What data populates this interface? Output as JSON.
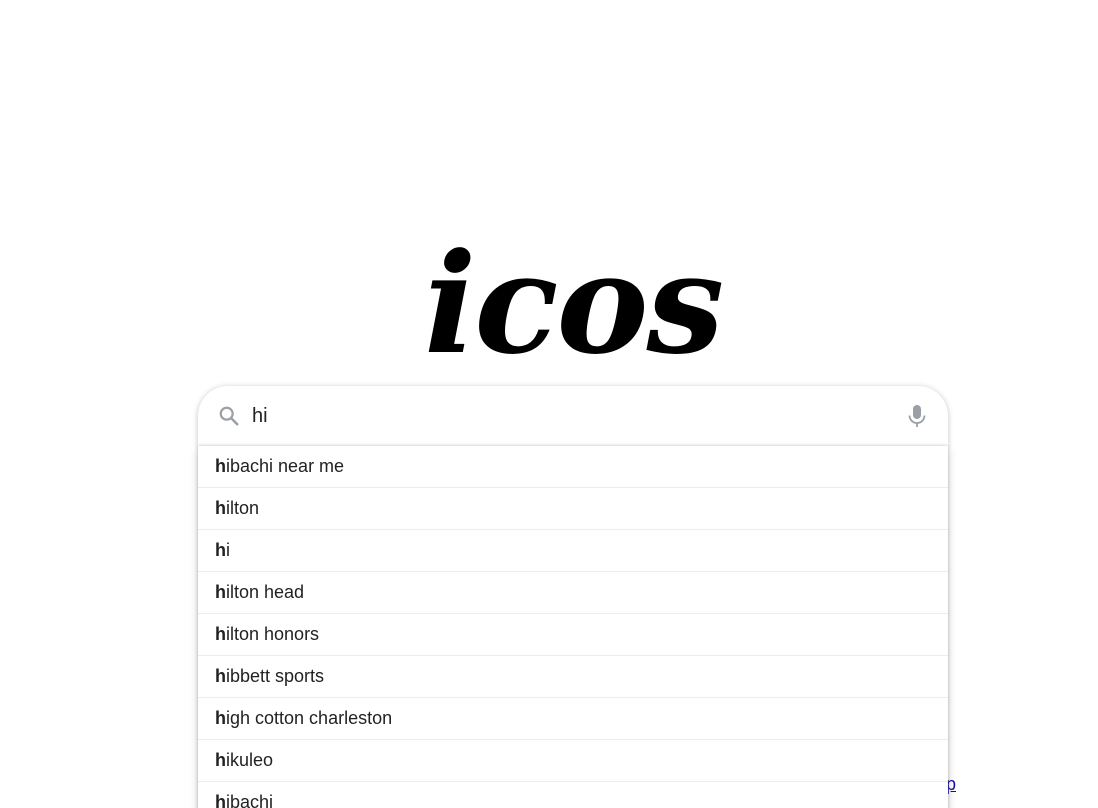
{
  "logo": {
    "text": "icos"
  },
  "search": {
    "value": "hi",
    "placeholder": ""
  },
  "suggestions": [
    {
      "prefix": "h",
      "rest": "ibachi near me"
    },
    {
      "prefix": "h",
      "rest": "ilton"
    },
    {
      "prefix": "h",
      "rest": "i"
    },
    {
      "prefix": "h",
      "rest": "ilton head"
    },
    {
      "prefix": "h",
      "rest": "ilton honors"
    },
    {
      "prefix": "h",
      "rest": "ibbett sports"
    },
    {
      "prefix": "h",
      "rest": "igh cotton charleston"
    },
    {
      "prefix": "h",
      "rest": "ikuleo"
    },
    {
      "prefix": "h",
      "rest": "ibachi"
    }
  ],
  "corner_link": {
    "text": "p"
  },
  "icons": {
    "search": "search-icon",
    "mic": "microphone-icon"
  },
  "colors": {
    "icon_gray": "#9aa0a6",
    "link_blue": "#1a0dab",
    "text": "#222222"
  }
}
